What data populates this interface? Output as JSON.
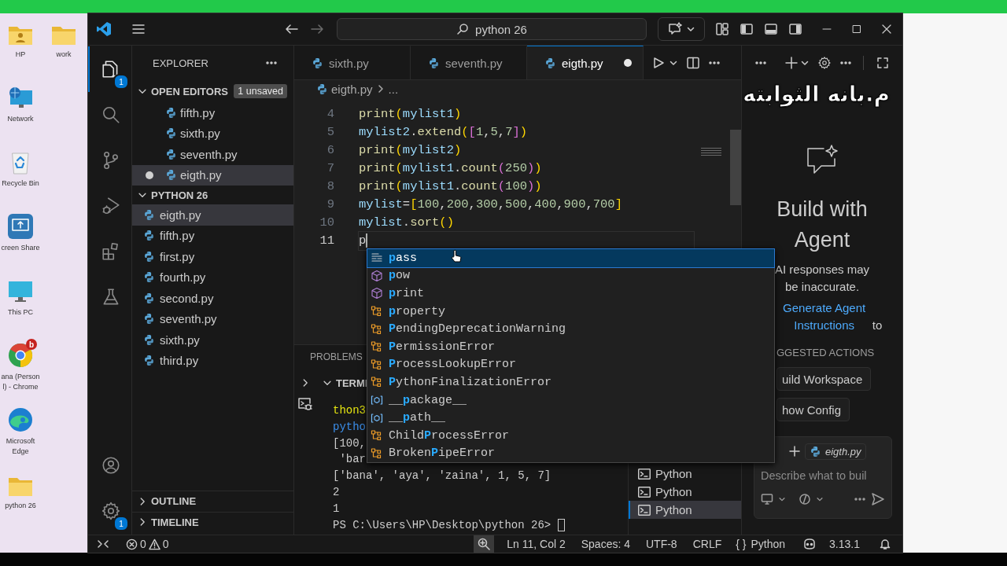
{
  "desktop": {
    "icons": [
      {
        "kind": "user-folder",
        "label": "HP"
      },
      {
        "kind": "folder",
        "label": "work"
      },
      {
        "kind": "network",
        "label": "Network"
      },
      {
        "kind": "recycle-bin",
        "label": "Recycle Bin"
      },
      {
        "kind": "screen-share",
        "label": "creen Share"
      },
      {
        "kind": "monitor",
        "label": "This PC"
      },
      {
        "kind": "browser",
        "label": "ana (Person l) - Chrome",
        "badge": "b"
      },
      {
        "kind": "edge",
        "label": "Microsoft Edge"
      },
      {
        "kind": "folder",
        "label": "python 26"
      }
    ]
  },
  "title_bar": {
    "search": "python 26",
    "forward_disabled": true
  },
  "activity_bar": {
    "top": [
      {
        "kind": "explorer",
        "selected": true,
        "badge": "1"
      },
      {
        "kind": "search",
        "selected": false
      },
      {
        "kind": "source-control",
        "selected": false
      },
      {
        "kind": "run-debug",
        "selected": false
      },
      {
        "kind": "extensions",
        "selected": false
      },
      {
        "kind": "testing",
        "selected": false
      }
    ],
    "bottom": [
      {
        "kind": "account",
        "selected": false
      },
      {
        "kind": "manage",
        "selected": false,
        "badge": "1"
      }
    ]
  },
  "sidebar": {
    "title": "EXPLORER",
    "open_editors": {
      "label": "OPEN EDITORS",
      "expanded": true,
      "badge": "1 unsaved",
      "items": [
        {
          "name": "fifth.py",
          "modified": false,
          "selected": false
        },
        {
          "name": "sixth.py",
          "modified": false,
          "selected": false
        },
        {
          "name": "seventh.py",
          "modified": false,
          "selected": false
        },
        {
          "name": "eigth.py",
          "modified": true,
          "selected": true
        }
      ]
    },
    "folder": {
      "label": "PYTHON 26",
      "expanded": true,
      "items": [
        {
          "name": "eigth.py",
          "selected": true
        },
        {
          "name": "fifth.py",
          "selected": false
        },
        {
          "name": "first.py",
          "selected": false
        },
        {
          "name": "fourth.py",
          "selected": false
        },
        {
          "name": "second.py",
          "selected": false
        },
        {
          "name": "seventh.py",
          "selected": false
        },
        {
          "name": "sixth.py",
          "selected": false
        },
        {
          "name": "third.py",
          "selected": false
        }
      ]
    },
    "sections": [
      {
        "label": "OUTLINE",
        "expanded": false
      },
      {
        "label": "TIMELINE",
        "expanded": false
      }
    ]
  },
  "editor": {
    "tabs": [
      {
        "label": "sixth.py",
        "selected": false,
        "modified": false
      },
      {
        "label": "seventh.py",
        "selected": false,
        "modified": false
      },
      {
        "label": "eigth.py",
        "selected": true,
        "modified": true
      }
    ],
    "breadcrumb": [
      "eigth.py",
      "..."
    ],
    "lines": [
      {
        "number": "4",
        "current": false,
        "tokens": [
          {
            "text": "print",
            "kind": "fn"
          },
          {
            "text": "(",
            "kind": "b1"
          },
          {
            "text": "mylist1",
            "kind": "var"
          },
          {
            "text": ")",
            "kind": "b1"
          }
        ]
      },
      {
        "number": "5",
        "current": false,
        "tokens": [
          {
            "text": "mylist2",
            "kind": "var"
          },
          {
            "text": ".",
            "kind": "op"
          },
          {
            "text": "extend",
            "kind": "fn"
          },
          {
            "text": "(",
            "kind": "b1"
          },
          {
            "text": "[",
            "kind": "b2"
          },
          {
            "text": "1",
            "kind": "num"
          },
          {
            "text": ",",
            "kind": "op"
          },
          {
            "text": "5",
            "kind": "num"
          },
          {
            "text": ",",
            "kind": "op"
          },
          {
            "text": "7",
            "kind": "num"
          },
          {
            "text": "]",
            "kind": "b2"
          },
          {
            "text": ")",
            "kind": "b1"
          }
        ]
      },
      {
        "number": "6",
        "current": false,
        "tokens": [
          {
            "text": "print",
            "kind": "fn"
          },
          {
            "text": "(",
            "kind": "b1"
          },
          {
            "text": "mylist2",
            "kind": "var"
          },
          {
            "text": ")",
            "kind": "b1"
          }
        ]
      },
      {
        "number": "7",
        "current": false,
        "tokens": [
          {
            "text": "print",
            "kind": "fn"
          },
          {
            "text": "(",
            "kind": "b1"
          },
          {
            "text": "mylist1",
            "kind": "var"
          },
          {
            "text": ".",
            "kind": "op"
          },
          {
            "text": "count",
            "kind": "fn"
          },
          {
            "text": "(",
            "kind": "b2"
          },
          {
            "text": "250",
            "kind": "num"
          },
          {
            "text": ")",
            "kind": "b2"
          },
          {
            "text": ")",
            "kind": "b1"
          }
        ]
      },
      {
        "number": "8",
        "current": false,
        "tokens": [
          {
            "text": "print",
            "kind": "fn"
          },
          {
            "text": "(",
            "kind": "b1"
          },
          {
            "text": "mylist1",
            "kind": "var"
          },
          {
            "text": ".",
            "kind": "op"
          },
          {
            "text": "count",
            "kind": "fn"
          },
          {
            "text": "(",
            "kind": "b2"
          },
          {
            "text": "100",
            "kind": "num"
          },
          {
            "text": ")",
            "kind": "b2"
          },
          {
            "text": ")",
            "kind": "b1"
          }
        ]
      },
      {
        "number": "9",
        "current": false,
        "tokens": [
          {
            "text": "mylist",
            "kind": "var"
          },
          {
            "text": "=",
            "kind": "op"
          },
          {
            "text": "[",
            "kind": "b1"
          },
          {
            "text": "100",
            "kind": "num"
          },
          {
            "text": ",",
            "kind": "op"
          },
          {
            "text": "200",
            "kind": "num"
          },
          {
            "text": ",",
            "kind": "op"
          },
          {
            "text": "300",
            "kind": "num"
          },
          {
            "text": ",",
            "kind": "op"
          },
          {
            "text": "500",
            "kind": "num"
          },
          {
            "text": ",",
            "kind": "op"
          },
          {
            "text": "400",
            "kind": "num"
          },
          {
            "text": ",",
            "kind": "op"
          },
          {
            "text": "900",
            "kind": "num"
          },
          {
            "text": ",",
            "kind": "op"
          },
          {
            "text": "700",
            "kind": "num"
          },
          {
            "text": "]",
            "kind": "b1"
          }
        ]
      },
      {
        "number": "10",
        "current": false,
        "tokens": [
          {
            "text": "mylist",
            "kind": "var"
          },
          {
            "text": ".",
            "kind": "op"
          },
          {
            "text": "sort",
            "kind": "fn"
          },
          {
            "text": "()",
            "kind": "b1"
          }
        ]
      },
      {
        "number": "11",
        "current": true,
        "tokens": [
          {
            "text": "p",
            "kind": "op"
          }
        ]
      }
    ]
  },
  "suggestions": [
    {
      "kind": "keyword",
      "match": "p",
      "after": "ass",
      "selected": true
    },
    {
      "kind": "function",
      "match": "p",
      "after": "ow",
      "selected": false
    },
    {
      "kind": "function",
      "match": "p",
      "after": "rint",
      "selected": false
    },
    {
      "kind": "class",
      "match": "p",
      "after": "roperty",
      "selected": false
    },
    {
      "kind": "class",
      "match": "P",
      "after": "endingDeprecationWarning",
      "selected": false
    },
    {
      "kind": "class",
      "match": "P",
      "after": "ermissionError",
      "selected": false
    },
    {
      "kind": "class",
      "match": "P",
      "after": "rocessLookupError",
      "selected": false
    },
    {
      "kind": "class",
      "match": "P",
      "after": "ythonFinalizationError",
      "selected": false
    },
    {
      "kind": "variable",
      "before": "__",
      "match": "p",
      "after": "ackage__",
      "selected": false
    },
    {
      "kind": "variable",
      "before": "__",
      "match": "p",
      "after": "ath__",
      "selected": false
    },
    {
      "kind": "class",
      "before": "Child",
      "match": "P",
      "after": "rocessError",
      "selected": false
    },
    {
      "kind": "class",
      "before": "Broken",
      "match": "P",
      "after": "ipeError",
      "selected": false
    }
  ],
  "panel": {
    "tabs": [
      {
        "label": "PROBLEMS",
        "selected": false
      }
    ],
    "terminal_header": {
      "label": "TERMI",
      "expanded": true
    },
    "terminal_lines": [
      {
        "text": "thon3",
        "kind": "command"
      },
      {
        "text": "pytho",
        "kind": "link"
      },
      {
        "text": "[100,",
        "kind": "output"
      },
      {
        "text": " 'bar",
        "kind": "output"
      },
      {
        "text": "['bana', 'aya', 'zaina', 1, 5, 7]",
        "kind": "output"
      },
      {
        "text": "2",
        "kind": "output"
      },
      {
        "text": "1",
        "kind": "output"
      }
    ],
    "prompt": "PS C:\\Users\\HP\\Desktop\\python 26> ",
    "terminals": [
      {
        "label": "Python",
        "selected": false
      },
      {
        "label": "Python",
        "selected": false
      },
      {
        "label": "Python",
        "selected": true
      }
    ]
  },
  "chat": {
    "overlay_caption": "م.بانه الثوابته",
    "title": "Build with Agent",
    "disclaimer": "AI responses may be inaccurate.",
    "hint": {
      "link": "Generate Agent Instructions",
      "text": " to"
    },
    "section": "GGESTED ACTIONS",
    "actions": [
      "uild Workspace",
      "how Config"
    ],
    "context_file": "eigth.py",
    "placeholder": "Describe what to buil"
  },
  "status_bar": {
    "errors": "0",
    "warnings": "0",
    "position": "Ln 11, Col 2",
    "indentation": "Spaces: 4",
    "encoding": "UTF-8",
    "line_ending": "CRLF",
    "language_icon": "{ }",
    "language": "Python",
    "version": "3.13.1"
  }
}
